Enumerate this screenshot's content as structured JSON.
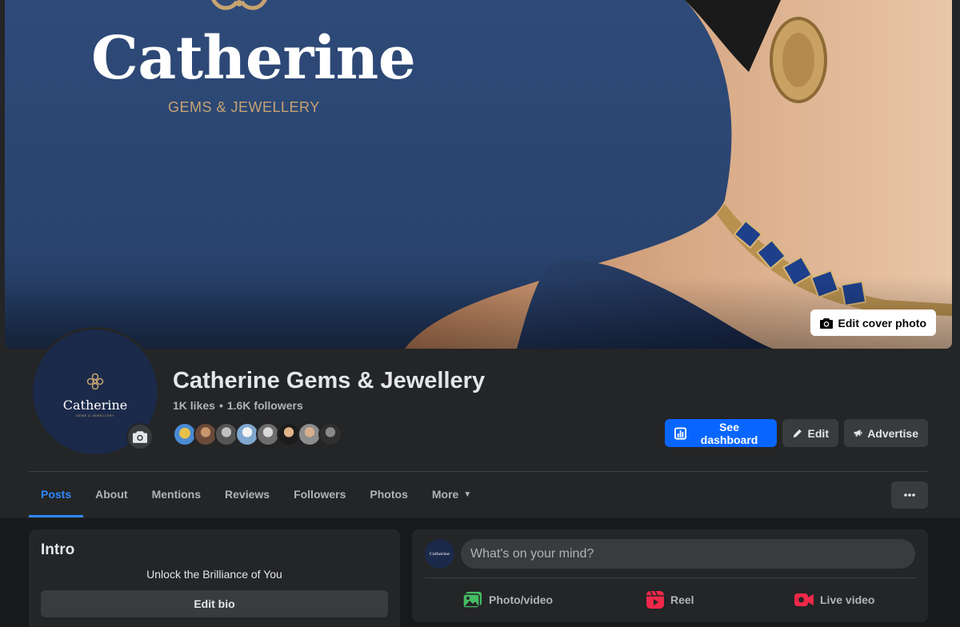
{
  "cover": {
    "brand_title": "Catherine",
    "brand_subtitle": "GEMS & JEWELLERY",
    "edit_cover_label": "Edit cover photo"
  },
  "profile": {
    "avatar_title": "Catherine",
    "avatar_subtitle": "GEMS & JEWELLERY",
    "name": "Catherine Gems & Jewellery",
    "likes": "1K likes",
    "separator": "•",
    "followers": "1.6K followers"
  },
  "actions": {
    "dashboard_label": "See dashboard",
    "edit_label": "Edit",
    "advertise_label": "Advertise"
  },
  "tabs": [
    {
      "label": "Posts"
    },
    {
      "label": "About"
    },
    {
      "label": "Mentions"
    },
    {
      "label": "Reviews"
    },
    {
      "label": "Followers"
    },
    {
      "label": "Photos"
    },
    {
      "label": "More"
    }
  ],
  "intro": {
    "title": "Intro",
    "bio": "Unlock the Brilliance of You",
    "edit_bio_label": "Edit bio"
  },
  "composer": {
    "avatar_text": "Catherine",
    "placeholder": "What's on your mind?",
    "photo_label": "Photo/video",
    "reel_label": "Reel",
    "live_label": "Live video"
  },
  "colors": {
    "accent": "#0866ff",
    "active_tab": "#2d88ff",
    "surface": "#242526",
    "background": "#18191a",
    "cover_blue": "#2e4a78",
    "gold": "#c7a371"
  }
}
